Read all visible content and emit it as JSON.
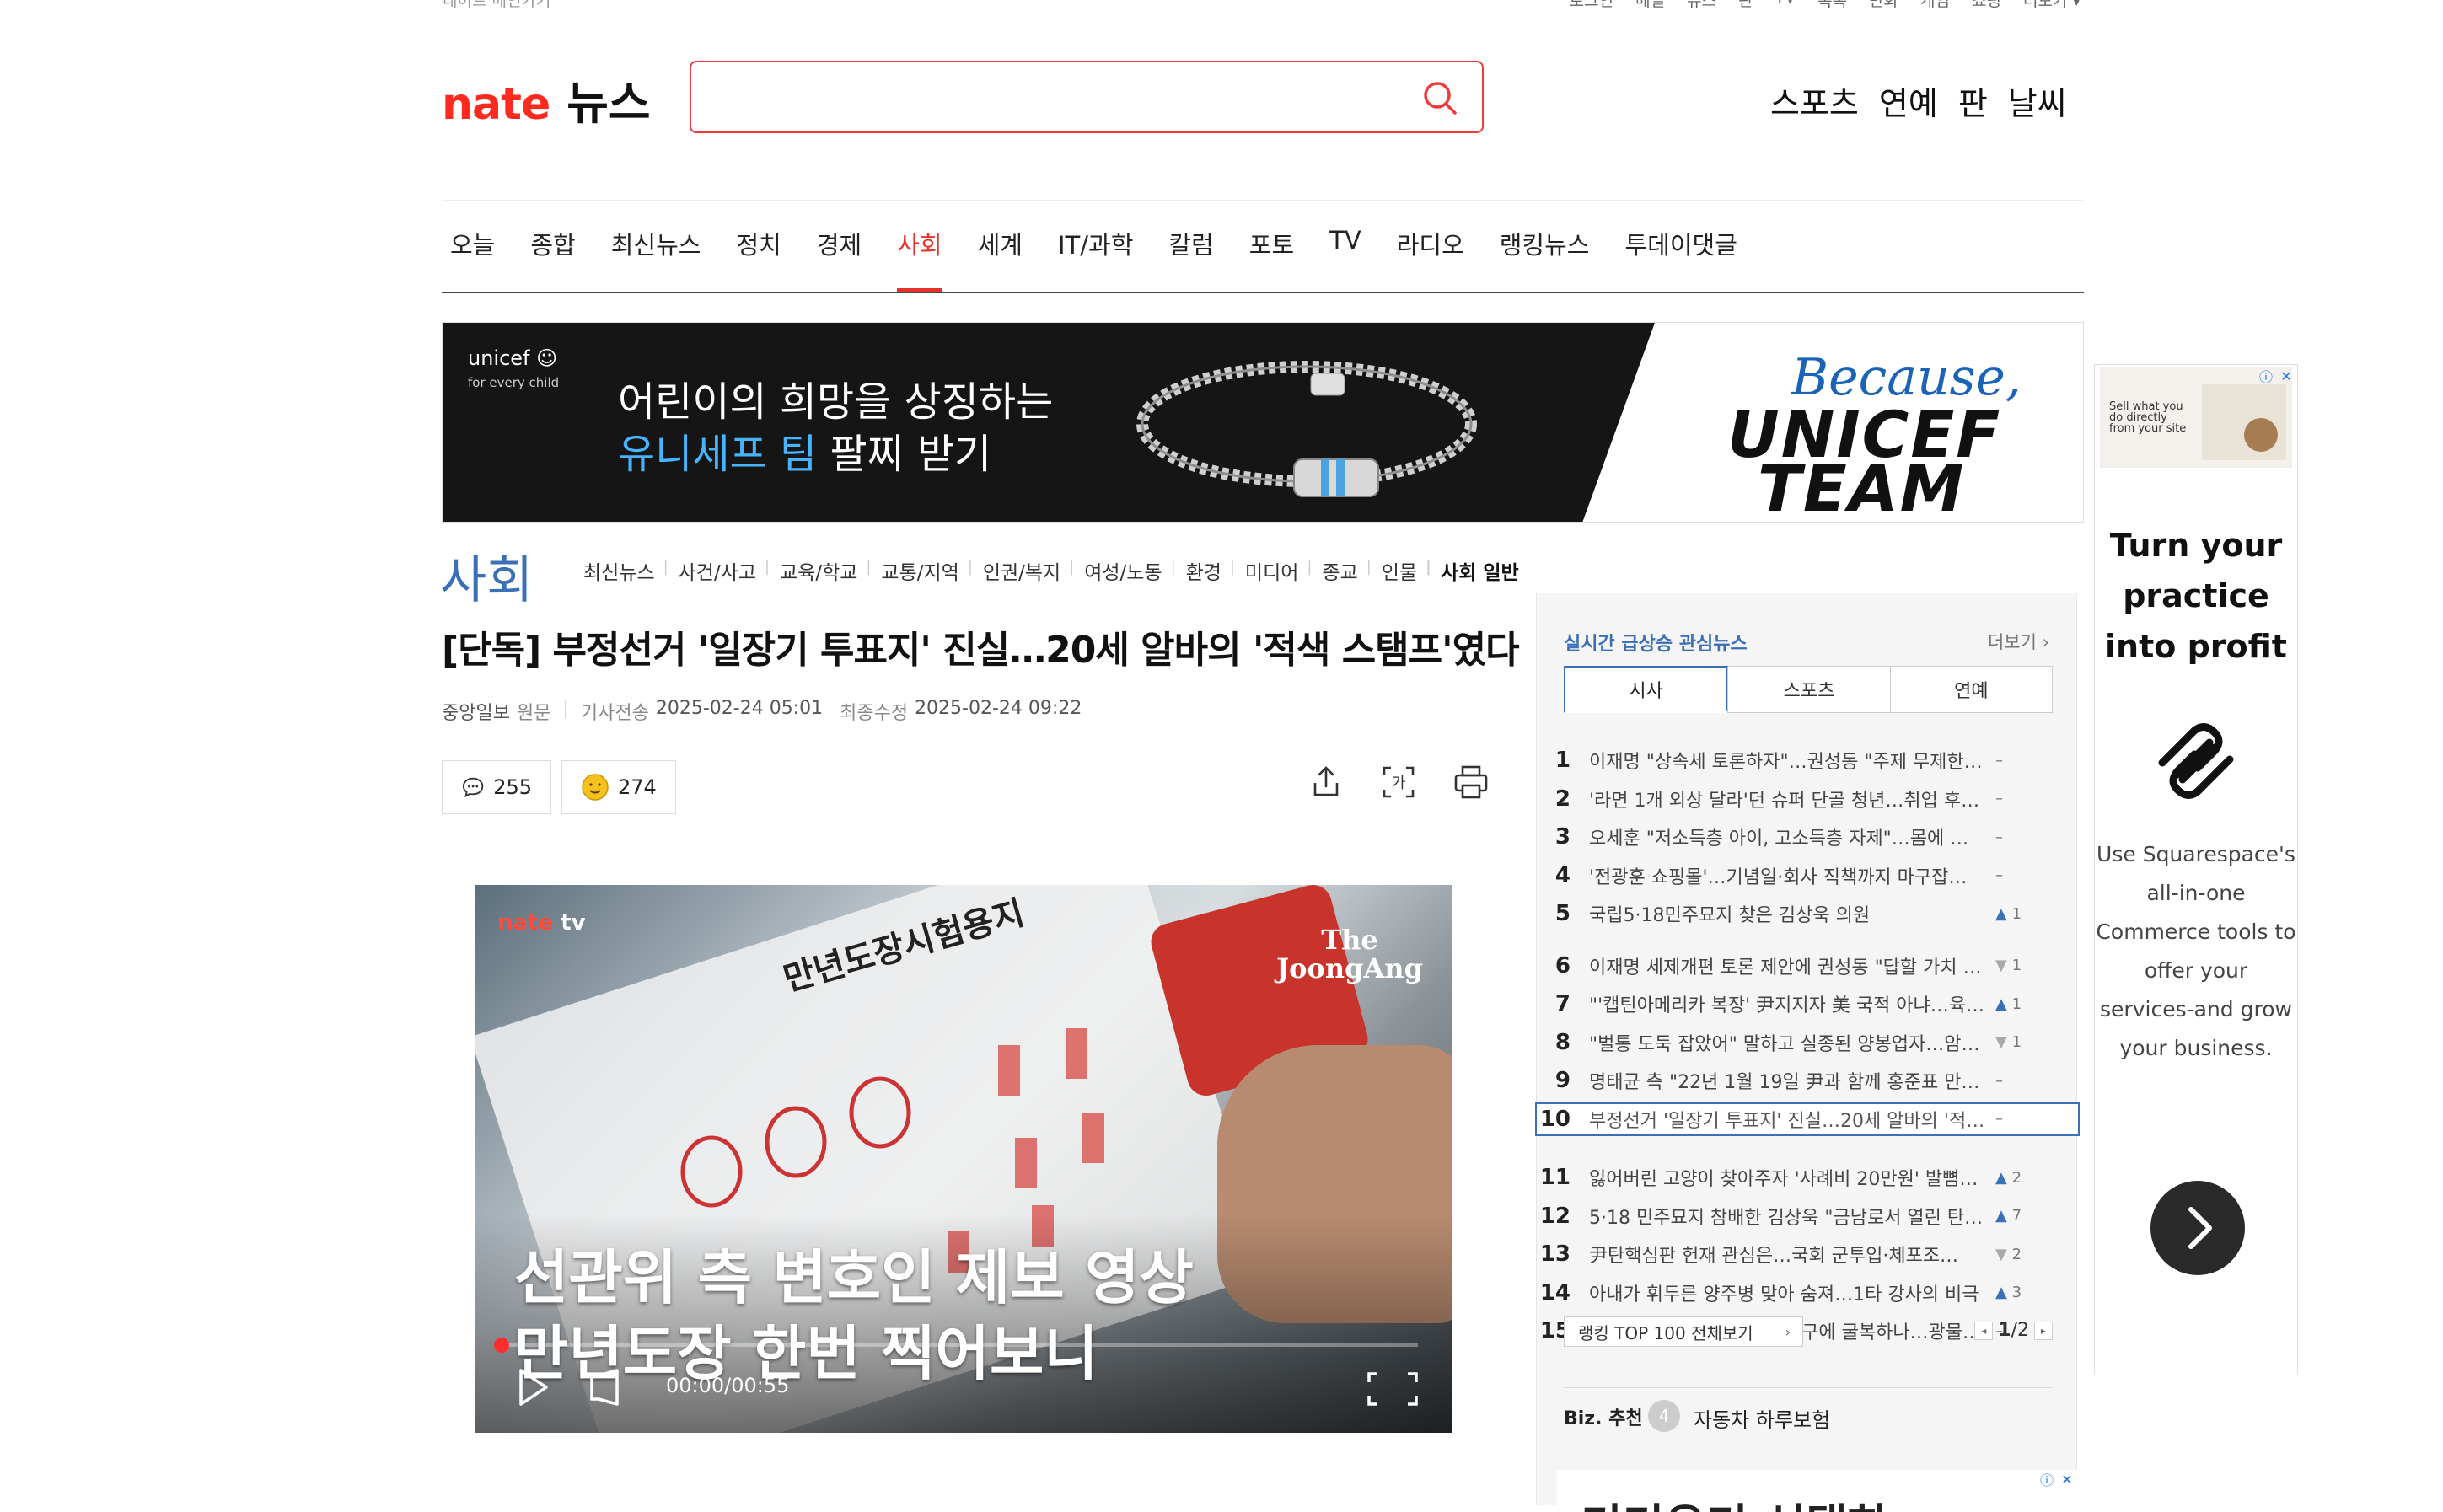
{
  "topbar": {
    "left": "네이트 메인가기",
    "right_links": [
      "로그인",
      "메일",
      "뉴스",
      "판",
      "TV",
      "톡톡",
      "만화",
      "게임",
      "쇼핑",
      "더보기 ▾"
    ]
  },
  "logo": {
    "brand": "nate",
    "section": "뉴스"
  },
  "search": {
    "value": "",
    "placeholder": ""
  },
  "services": [
    "스포츠",
    "연예",
    "판",
    "날씨"
  ],
  "gnb": {
    "items": [
      "오늘",
      "종합",
      "최신뉴스",
      "정치",
      "경제",
      "사회",
      "세계",
      "IT/과학",
      "칼럼",
      "포토",
      "TV",
      "라디오",
      "랭킹뉴스",
      "투데이댓글"
    ],
    "active": "사회"
  },
  "banner": {
    "brand": "unicef",
    "brand_sub": "for every child",
    "line1": "어린이의 희망을 상징하는",
    "line2_blue": "유니세프 팀",
    "line2_rest": " 팔찌 받기",
    "script": "Because,",
    "team1": "UNICEF",
    "team2": "TEAM"
  },
  "section": {
    "title": "사회",
    "sub_nav": [
      "최신뉴스",
      "사건/사고",
      "교육/학교",
      "교통/지역",
      "인권/복지",
      "여성/노동",
      "환경",
      "미디어",
      "종교",
      "인물",
      "사회 일반"
    ],
    "sub_active": "사회 일반"
  },
  "article": {
    "headline": "[단독] 부정선거 '일장기 투표지' 진실…20세 알바의 '적색 스탬프'였다",
    "press": "중앙일보",
    "source": "원문",
    "sent_label": "기사전송",
    "sent_time": "2025-02-24 05:01",
    "mod_label": "최종수정",
    "mod_time": "2025-02-24 09:22",
    "comments": "255",
    "reactions": "274"
  },
  "video": {
    "channel_a": "nate",
    "channel_b": "tv",
    "paper_title": "만년도장시험용지",
    "publisher_line1": "The",
    "publisher_line2": "JoongAng",
    "caption1": "선관위 측 변호인 제보 영상",
    "caption2": "만년도장 한번 찍어보니",
    "time": "00:00/00:55",
    "progress": 0.0
  },
  "ranking": {
    "title": "실시간 급상승 관심뉴스",
    "more": "더보기",
    "tabs": [
      "시사",
      "스포츠",
      "연예"
    ],
    "active_tab": "시사",
    "items": [
      {
        "rank": "1",
        "text": "이재명 \"상속세 토론하자\"…권성동 \"주제 무제한…",
        "change": "–",
        "dir": "same"
      },
      {
        "rank": "2",
        "text": "'라면 1개 외상 달라'던 슈퍼 단골 청년…취업 후 …",
        "change": "–",
        "dir": "same"
      },
      {
        "rank": "3",
        "text": "오세훈 \"저소득층 아이, 고소득층 자제\"…몸에 …",
        "change": "–",
        "dir": "same"
      },
      {
        "rank": "4",
        "text": "'전광훈 쇼핑몰'…기념일·회사 직책까지 마구잡…",
        "change": "–",
        "dir": "same"
      },
      {
        "rank": "5",
        "text": "국립5·18민주묘지 찾은 김상욱 의원",
        "change": "1",
        "dir": "up"
      },
      {
        "rank": "6",
        "text": "이재명 세제개편 토론 제안에 권성동 \"답할 가치 …",
        "change": "1",
        "dir": "down"
      },
      {
        "rank": "7",
        "text": "\"'캡틴아메리카 복장' 尹지지자 美 국적 아냐…육…",
        "change": "1",
        "dir": "up"
      },
      {
        "rank": "8",
        "text": "\"벌통 도둑 잡았어\" 말하고 실종된 양봉업자…암…",
        "change": "1",
        "dir": "down"
      },
      {
        "rank": "9",
        "text": "명태균 측 \"22년 1월 19일 尹과 함께 홍준표 만났…",
        "change": "–",
        "dir": "same"
      },
      {
        "rank": "10",
        "text": "부정선거 '일장기 투표지' 진실…20세 알바의 '적색 스…",
        "change": "–",
        "dir": "same"
      },
      {
        "rank": "11",
        "text": "잃어버린 고양이 찾아주자 '사례비 20만원' 발뼘…",
        "change": "2",
        "dir": "up"
      },
      {
        "rank": "12",
        "text": "5·18 민주묘지 참배한 김상욱 \"금남로서 열린 탄…",
        "change": "7",
        "dir": "up"
      },
      {
        "rank": "13",
        "text": "尹탄핵심판 헌재 관심은…국회 군투입·체포조…",
        "change": "2",
        "dir": "down"
      },
      {
        "rank": "14",
        "text": "아내가 휘두른 양주병 맞아 숨져…1타 강사의 비극",
        "change": "3",
        "dir": "up"
      },
      {
        "rank": "15",
        "text": "우크라, 트럼프 720조원 요구에 굴복하나…광물…",
        "change": "–",
        "dir": "same"
      }
    ],
    "highlight_rank": "10",
    "view_all": "랭킹 TOP 100 전체보기",
    "page": "1",
    "pages": "/2",
    "biz_label": "Biz. 추천",
    "biz_num": "4",
    "biz_text": "자동차 하루보험",
    "ad_text": "기기우기 선택하"
  },
  "side_ad": {
    "thumb_text": "Sell what you do directly from your site",
    "title": "Turn your practice into profit",
    "body": "Use Squarespace's all-in-one Commerce tools to offer your services-and grow your business."
  }
}
